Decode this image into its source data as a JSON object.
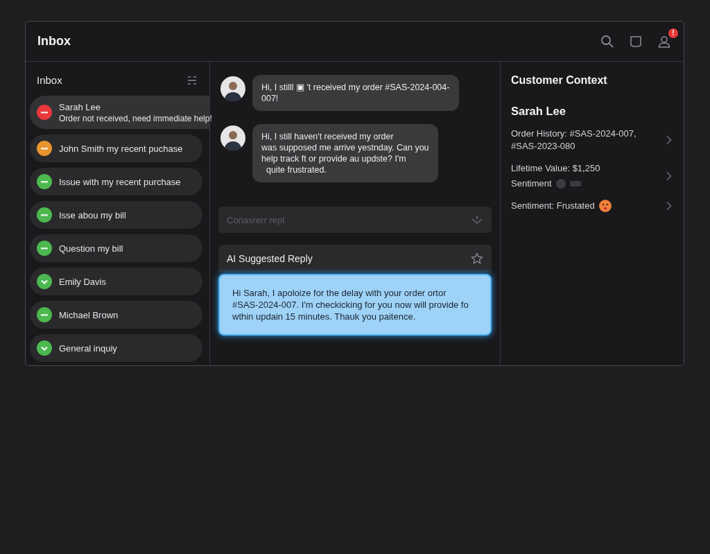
{
  "window": {
    "title": "Inbox",
    "notification_badge": "!"
  },
  "sidebar": {
    "title": "Inbox",
    "items": [
      {
        "kind": "dot",
        "color": "#e8383d",
        "name": "Sarah Lee",
        "preview": "Order not received, need immediate help!",
        "selected": true
      },
      {
        "kind": "dot",
        "color": "#e8952f",
        "name": "John Smith my recent puchase",
        "selected": false
      },
      {
        "kind": "dot",
        "color": "#4cb84f",
        "name": "Issue with my recent purchase",
        "selected": false
      },
      {
        "kind": "dot",
        "color": "#4cb84f",
        "name": "Isse abou my bill",
        "selected": false
      },
      {
        "kind": "dot",
        "color": "#4cb84f",
        "name": "Question my bill",
        "selected": false
      },
      {
        "kind": "chevron",
        "color": "#4cb84f",
        "name": "Emily Davis",
        "selected": false
      },
      {
        "kind": "dot",
        "color": "#4cb84f",
        "name": "Michael Brown",
        "selected": false
      },
      {
        "kind": "chevron",
        "color": "#4cb84f",
        "name": "General inquiy",
        "selected": false
      }
    ]
  },
  "messages": [
    {
      "text": "Hi, I stilll ▣ 't received my order #SAS-2024-004-007!"
    },
    {
      "text": "Hi, I still haven't received my order\nwas supposed me arrive yestnday. Can you\nhelp track ft or provide au updste? I'm\n  quite frustrated."
    }
  ],
  "compose": {
    "placeholder": "Conasrerr repl"
  },
  "ai_reply": {
    "title": "AI Suggested Reply",
    "text": "Hi Sarah, I apoloize for the delay with your order ortor\n#SAS-2024-007. I'm checkicking for you now will provide fo\nwthin updain 15 minutes. Thauk you paitence."
  },
  "context": {
    "title": "Customer Context",
    "customer": "Sarah Lee",
    "rows": [
      {
        "kind": "text",
        "text": "Order History: #SAS-2024-007,\n#SAS-2023-080"
      },
      {
        "kind": "blurred",
        "text": "Lifetime Value: $1,250",
        "label": "Sentiment"
      },
      {
        "kind": "emoji",
        "text": "Sentiment: Frustated"
      }
    ]
  }
}
